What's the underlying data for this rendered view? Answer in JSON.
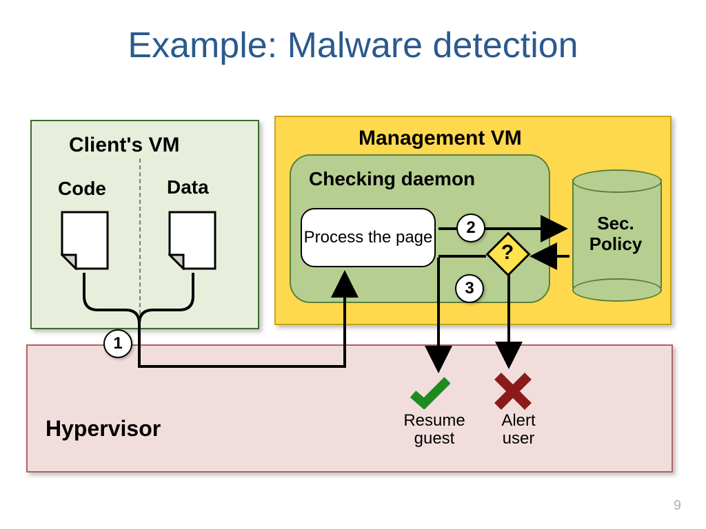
{
  "title": "Example: Malware detection",
  "slide_number": "9",
  "client_vm": {
    "title": "Client's VM",
    "code": "Code",
    "data": "Data"
  },
  "management_vm": {
    "title": "Management VM",
    "daemon": {
      "title": "Checking daemon",
      "process": "Process the page",
      "decision": "?"
    },
    "sec_policy": "Sec.\nPolicy"
  },
  "hypervisor": {
    "title": "Hypervisor",
    "resume": "Resume guest",
    "alert": "Alert user"
  },
  "steps": {
    "s1": "1",
    "s2": "2",
    "s3": "3"
  },
  "icons": {
    "page": "page-icon",
    "decision": "decision-diamond-icon",
    "check": "check-icon",
    "cross": "cross-icon",
    "cylinder": "database-cylinder-icon"
  },
  "colors": {
    "title": "#2a5a8e",
    "client_bg": "#e7efdc",
    "mgmt_bg": "#ffd94d",
    "daemon_bg": "#b6cf90",
    "hyper_bg": "#f2dddd",
    "check": "#1f8b1f",
    "cross": "#8b1a1a"
  }
}
